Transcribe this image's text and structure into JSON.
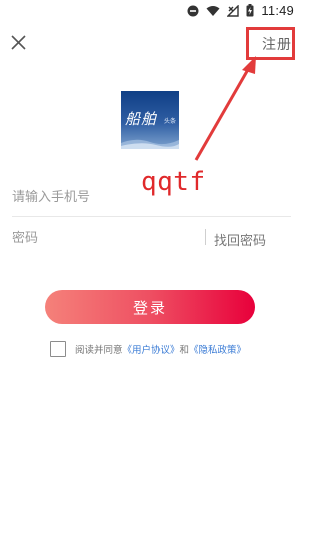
{
  "status_bar": {
    "time": "11:49",
    "icons": [
      "dnd-icon",
      "wifi-icon",
      "no-signal-icon",
      "battery-charging-icon"
    ]
  },
  "header": {
    "close_icon": "close-icon",
    "register_label": "注册"
  },
  "logo": {
    "text": "船舶",
    "subtext": "头条"
  },
  "watermark": "qqtf",
  "form": {
    "phone_placeholder": "请输入手机号",
    "password_placeholder": "密码",
    "forgot_label": "找回密码"
  },
  "login_button": "登录",
  "agreement": {
    "prefix": "阅读并同意",
    "user_agreement": "《用户协议》",
    "and": "和",
    "privacy_policy": "《隐私政策》"
  },
  "colors": {
    "accent": "#e8003b",
    "gradient_start": "#f5817a",
    "link": "#3a7bd5",
    "annotation": "#e23b3b",
    "watermark": "#e0292b"
  }
}
